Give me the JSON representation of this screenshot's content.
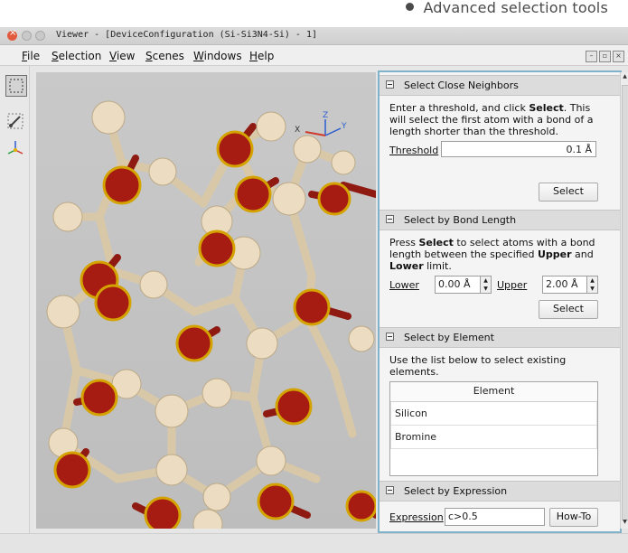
{
  "caption": {
    "text": "Advanced selection tools"
  },
  "window": {
    "title": "Viewer - [DeviceConfiguration (Si-Si3N4-Si) - 1]",
    "menu": [
      {
        "label": "File",
        "key": "F",
        "rest": "ile"
      },
      {
        "label": "Selection",
        "key": "S",
        "rest": "election"
      },
      {
        "label": "View",
        "key": "V",
        "rest": "iew"
      },
      {
        "label": "Scenes",
        "key": "S",
        "rest": "cenes"
      },
      {
        "label": "Windows",
        "key": "W",
        "rest": "indows"
      },
      {
        "label": "Help",
        "key": "H",
        "rest": "elp"
      }
    ]
  },
  "toolbar": {
    "tools": [
      "rectangle-select-icon",
      "distance-measure-icon",
      "axes-icon"
    ]
  },
  "axes_gizmo": {
    "x": "X",
    "y": "Y",
    "z": "Z"
  },
  "panel": {
    "close_neighbors": {
      "title": "Select Close Neighbors",
      "desc_1": "Enter a threshold, and click ",
      "desc_bold": "Select",
      "desc_2": ". This will select the first atom with a bond of a length shorter than the threshold.",
      "threshold_label": "Threshold",
      "threshold_value": "0.1 Å",
      "select_button": "Select"
    },
    "bond_length": {
      "title": "Select by Bond Length",
      "desc_1": "Press ",
      "desc_bold_1": "Select",
      "desc_2": " to select atoms with a bond length between the specified ",
      "desc_bold_2": "Upper",
      "desc_3": " and ",
      "desc_bold_3": "Lower",
      "desc_4": " limit.",
      "lower_label": "Lower",
      "lower_value": "0.00 Å",
      "upper_label": "Upper",
      "upper_value": "2.00 Å",
      "select_button": "Select"
    },
    "element": {
      "title": "Select by Element",
      "desc": "Use the list below to select existing elements.",
      "column_header": "Element",
      "rows": [
        "Silicon",
        "Bromine"
      ]
    },
    "expression": {
      "title": "Select by Expression",
      "label": "Expression",
      "value": "c>0.5",
      "howto_button": "How-To"
    }
  },
  "colors": {
    "oxygen_red": "#a61b12",
    "selection_ring": "#d4a300",
    "silicon_beige": "#e8d9c0",
    "panel_border": "#80b3c9"
  }
}
